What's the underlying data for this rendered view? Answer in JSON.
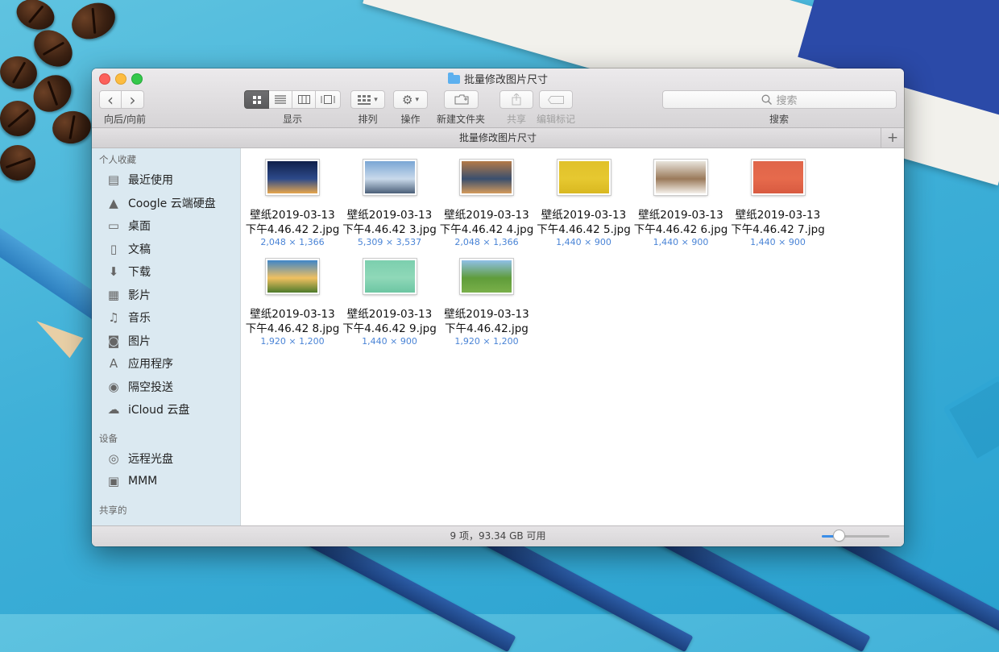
{
  "window": {
    "title": "批量修改图片尺寸",
    "path_title": "批量修改图片尺寸",
    "status": "9 项，93.34 GB 可用",
    "icon_size_slider": 0.25
  },
  "toolbar": {
    "nav_label": "向后/向前",
    "view_label": "显示",
    "sort_label": "排列",
    "action_label": "操作",
    "new_folder_label": "新建文件夹",
    "share_label": "共享",
    "tag_label": "编辑标记",
    "search_placeholder": "搜索",
    "search_label": "搜索",
    "back_icon": "‹",
    "fwd_icon": "›"
  },
  "sidebar": {
    "sections": [
      {
        "header": "个人收藏",
        "items": [
          {
            "label": "最近使用",
            "icon": "recents-icon",
            "glyph": "▤"
          },
          {
            "label": "Coogle 云端硬盘",
            "icon": "drive-icon",
            "glyph": "▲"
          },
          {
            "label": "桌面",
            "icon": "desktop-icon",
            "glyph": "▭"
          },
          {
            "label": "文稿",
            "icon": "documents-icon",
            "glyph": "▯"
          },
          {
            "label": "下载",
            "icon": "downloads-icon",
            "glyph": "⬇"
          },
          {
            "label": "影片",
            "icon": "movies-icon",
            "glyph": "▦"
          },
          {
            "label": "音乐",
            "icon": "music-icon",
            "glyph": "♫"
          },
          {
            "label": "图片",
            "icon": "pictures-icon",
            "glyph": "◙"
          },
          {
            "label": "应用程序",
            "icon": "applications-icon",
            "glyph": "A"
          },
          {
            "label": "隔空投送",
            "icon": "airdrop-icon",
            "glyph": "◉"
          },
          {
            "label": "iCloud 云盘",
            "icon": "icloud-icon",
            "glyph": "☁"
          }
        ]
      },
      {
        "header": "设备",
        "items": [
          {
            "label": "远程光盘",
            "icon": "remote-disc-icon",
            "glyph": "◎"
          },
          {
            "label": "MMM",
            "icon": "disk-icon",
            "glyph": "▣"
          }
        ]
      },
      {
        "header": "共享的",
        "items": []
      }
    ]
  },
  "files": [
    {
      "name1": "壁纸2019-03-13",
      "name2": "下午4.46.42 2.jpg",
      "dims": "2,048 × 1,366",
      "thumb": [
        "#0f1f4a",
        "#2d4a8a",
        "#e7a64c"
      ]
    },
    {
      "name1": "壁纸2019-03-13",
      "name2": "下午4.46.42 3.jpg",
      "dims": "5,309 × 3,537",
      "thumb": [
        "#7aa6d4",
        "#c9d9ea",
        "#4a5f78"
      ]
    },
    {
      "name1": "壁纸2019-03-13",
      "name2": "下午4.46.42 4.jpg",
      "dims": "2,048 × 1,366",
      "thumb": [
        "#b47a48",
        "#3a4f6e",
        "#d49a5c"
      ]
    },
    {
      "name1": "壁纸2019-03-13",
      "name2": "下午4.46.42 5.jpg",
      "dims": "1,440 × 900",
      "thumb": [
        "#e1c12a",
        "#e6c830",
        "#d9b820"
      ]
    },
    {
      "name1": "壁纸2019-03-13",
      "name2": "下午4.46.42 6.jpg",
      "dims": "1,440 × 900",
      "thumb": [
        "#e8e4dc",
        "#9a7a5a",
        "#f4f0ea"
      ]
    },
    {
      "name1": "壁纸2019-03-13",
      "name2": "下午4.46.42 7.jpg",
      "dims": "1,440 × 900",
      "thumb": [
        "#e0654a",
        "#e66a4c",
        "#d85a40"
      ]
    },
    {
      "name1": "壁纸2019-03-13",
      "name2": "下午4.46.42 8.jpg",
      "dims": "1,920 × 1,200",
      "thumb": [
        "#3f86c8",
        "#f0c060",
        "#4e7a2a"
      ]
    },
    {
      "name1": "壁纸2019-03-13",
      "name2": "下午4.46.42 9.jpg",
      "dims": "1,440 × 900",
      "thumb": [
        "#7ccfae",
        "#8fd8b8",
        "#6cc6a2"
      ]
    },
    {
      "name1": "壁纸2019-03-13",
      "name2": "下午4.46.42.jpg",
      "dims": "1,920 × 1,200",
      "thumb": [
        "#8fc0e8",
        "#5f9c3a",
        "#7ab04a"
      ]
    }
  ],
  "colors": {
    "accent": "#3b8ee8",
    "dims_text": "#4a84d6",
    "close": "#fc605b",
    "minimize": "#fdbc40",
    "maximize": "#34c84a"
  }
}
